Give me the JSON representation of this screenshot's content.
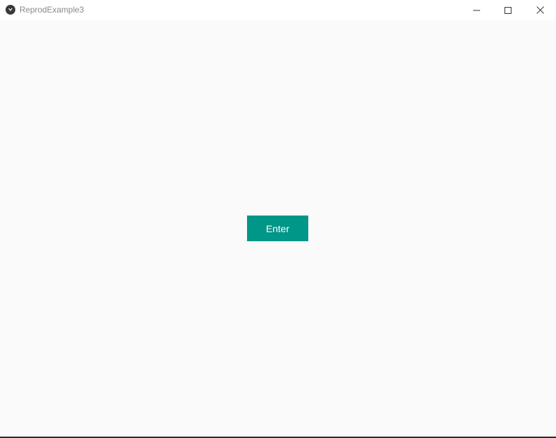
{
  "window": {
    "title": "ReprodExample3",
    "icon": "kivy-logo-icon",
    "controls": [
      "minimize-icon",
      "maximize-icon",
      "close-icon"
    ]
  },
  "main": {
    "button_label": "Enter"
  },
  "colors": {
    "background": "#fafafa",
    "titlebar": "#ffffff",
    "button": "#009688",
    "button_text": "#ffffff",
    "title_text": "#8a8a8a"
  }
}
